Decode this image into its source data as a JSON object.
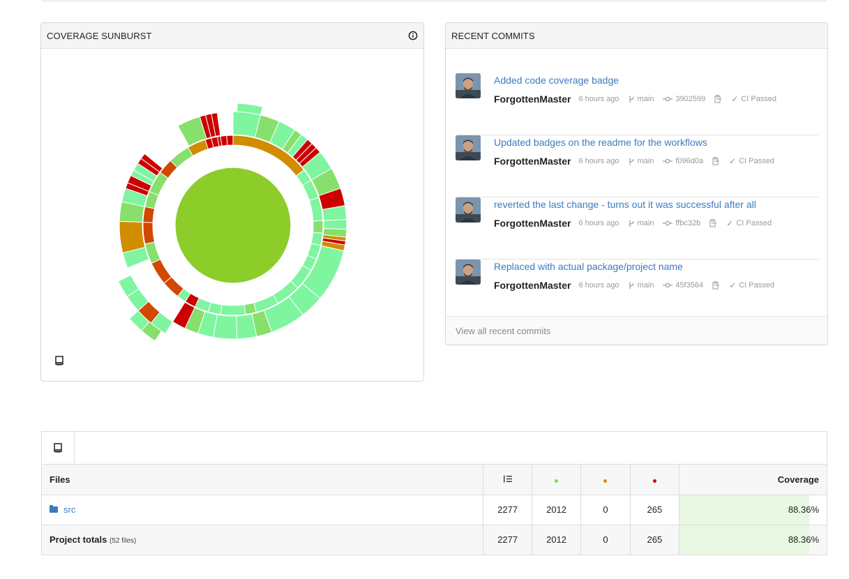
{
  "sunburst": {
    "title": "COVERAGE SUNBURST",
    "info_icon": "info-circle-icon",
    "footer_icon": "book-icon",
    "colors": {
      "high": "#8ccd2a",
      "light": "#7ff5a0",
      "medium_light": "#86e06b",
      "warn": "#d18c00",
      "orange": "#d14800",
      "red": "#cc0000"
    }
  },
  "commits": {
    "title": "RECENT COMMITS",
    "items": [
      {
        "title": "Added code coverage badge",
        "author": "ForgottenMaster",
        "time": "6 hours ago",
        "branch": "main",
        "sha": "3902599",
        "ci": "CI Passed"
      },
      {
        "title": "Updated badges on the readme for the workflows",
        "author": "ForgottenMaster",
        "time": "6 hours ago",
        "branch": "main",
        "sha": "f096d0a",
        "ci": "CI Passed"
      },
      {
        "title": "reverted the last change - turns out it was successful after all",
        "author": "ForgottenMaster",
        "time": "6 hours ago",
        "branch": "main",
        "sha": "ffbc32b",
        "ci": "CI Passed"
      },
      {
        "title": "Replaced with actual package/project name",
        "author": "ForgottenMaster",
        "time": "6 hours ago",
        "branch": "main",
        "sha": "45f3564",
        "ci": "CI Passed"
      }
    ],
    "view_all": "View all recent commits"
  },
  "files": {
    "headers": {
      "files": "Files",
      "coverage": "Coverage"
    },
    "header_icons": [
      "lines-icon",
      "hit-dot-icon",
      "partial-dot-icon",
      "miss-dot-icon"
    ],
    "dot_colors": {
      "hit": "#7fd45a",
      "partial": "#d18c00",
      "miss": "#cc0000"
    },
    "rows": [
      {
        "name": "src",
        "lines": "2277",
        "hits": "2012",
        "partials": "0",
        "misses": "265",
        "coverage": "88.36%",
        "coverage_value": 0.8836
      }
    ],
    "totals": {
      "label": "Project totals",
      "sub": "(52 files)",
      "lines": "2277",
      "hits": "2012",
      "partials": "0",
      "misses": "265",
      "coverage": "88.36%",
      "coverage_value": 0.8836
    }
  }
}
